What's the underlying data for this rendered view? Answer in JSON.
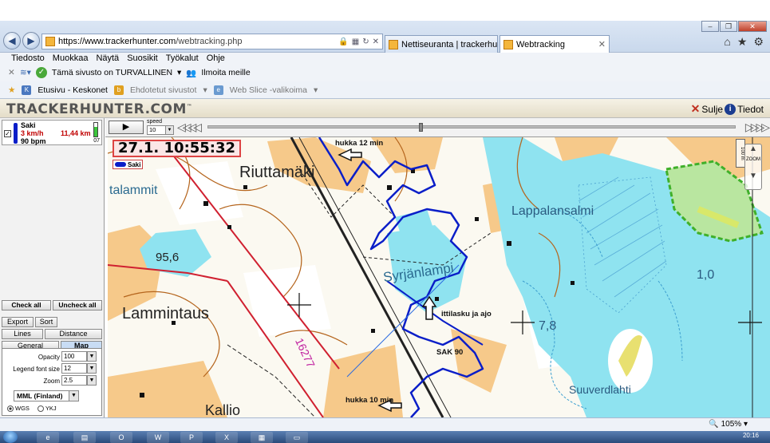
{
  "browser": {
    "url": "https://www.trackerhunter.com/webtracking.php",
    "url_host": "https://www.trackerhunter.com",
    "url_path": "/webtracking.php",
    "tabs": [
      {
        "label": "Nettiseuranta | trackerhunter.c...",
        "active": false
      },
      {
        "label": "Webtracking",
        "active": true
      }
    ],
    "menu": [
      "Tiedosto",
      "Muokkaa",
      "Näytä",
      "Suosikit",
      "Työkalut",
      "Ohje"
    ],
    "command_bar": {
      "safe_text": "Tämä sivusto on TURVALLINEN",
      "report_text": "Ilmoita meille"
    },
    "favorites": [
      {
        "label": "Etusivu - Keskonet"
      },
      {
        "label": "Ehdotetut sivustot"
      },
      {
        "label": "Web Slice -valikoima"
      }
    ],
    "zoom": "105%"
  },
  "app": {
    "logo": "TRACKERHUNTER.COM",
    "logo_tm": "™",
    "close_label": "Sulje",
    "info_label": "Tiedot"
  },
  "tracker": {
    "name": "Saki",
    "speed": "3 km/h",
    "distance": "11,44 km",
    "heart_rate": "90 bpm",
    "battery_code": "07",
    "color": "#0a1ec8",
    "checked": true
  },
  "left_panel": {
    "check_all": "Check all",
    "uncheck_all": "Uncheck all",
    "tabs_row1": [
      "Export",
      "Sort"
    ],
    "tabs_row2": [
      "Lines",
      "Distance"
    ],
    "tabs_row3": [
      "General",
      "Map"
    ],
    "selected_tab": "Map",
    "fields": [
      {
        "label": "Opacity",
        "value": "100"
      },
      {
        "label": "Legend font size",
        "value": "12"
      },
      {
        "label": "Zoom",
        "value": "2.5"
      }
    ],
    "map_type": "MML (Finland)",
    "coords": [
      {
        "label": "WGS",
        "selected": true
      },
      {
        "label": "YKJ",
        "selected": false
      }
    ]
  },
  "player": {
    "speed_label": "speed",
    "speed_value": "10",
    "progress": 0.4
  },
  "map": {
    "timestamp": "27.1. 10:55:32",
    "legend_name": "Saki",
    "zoom_label": "ZOOM",
    "scale_label": "100 m",
    "place_names": [
      "Riuttamäki",
      "Lappalansalmi",
      "Lammintaus",
      "Syrjänlampi",
      "Suuverdlahti",
      "Kallio",
      "talammit",
      "16277"
    ],
    "elevations": [
      "95,6",
      "7,8",
      "1,0"
    ],
    "annotations": [
      "hukka 12 min",
      "ittilasku ja ajo",
      "SAK 90",
      "hukka 10 min"
    ]
  },
  "taskbar": {
    "time": "20:16"
  }
}
